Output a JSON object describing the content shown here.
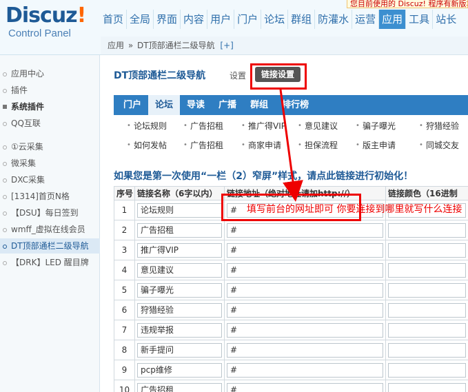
{
  "header": {
    "logo_title": "Discuz",
    "logo_bang": "!",
    "logo_subtitle": "Control Panel",
    "notice": "您目前使用的 Discuz! 程序有新版本",
    "nav": [
      "首页",
      "全局",
      "界面",
      "内容",
      "用户",
      "门户",
      "论坛",
      "群组",
      "防灌水",
      "运营",
      "应用",
      "工具",
      "站长"
    ],
    "nav_active_index": 10
  },
  "breadcrumb": {
    "root": "应用",
    "separator": "»",
    "current": "DT顶部通栏二级导航",
    "add": "[+]"
  },
  "sidebar": {
    "items": [
      {
        "label": "应用中心",
        "type": "item"
      },
      {
        "label": "插件",
        "type": "item"
      },
      {
        "label": "系统插件",
        "type": "group"
      },
      {
        "label": "QQ互联",
        "type": "item"
      },
      {
        "label": "①云采集",
        "type": "item"
      },
      {
        "label": "微采集",
        "type": "item"
      },
      {
        "label": "DXC采集",
        "type": "item"
      },
      {
        "label": "[1314]首页N格",
        "type": "item"
      },
      {
        "label": "【DSU】每日签到",
        "type": "item"
      },
      {
        "label": "wmff_虚拟在线会员",
        "type": "item"
      },
      {
        "label": "DT顶部通栏二级导航",
        "type": "current"
      },
      {
        "label": "【DRK】LED 醒目牌",
        "type": "item"
      }
    ]
  },
  "main": {
    "title": "DT顶部通栏二级导航",
    "tab_settings": "设置",
    "tab_links": "链接设置",
    "subnav": [
      "门户",
      "论坛",
      "导读",
      "广播",
      "群组",
      "排行榜"
    ],
    "subnav_active_index": 1,
    "menu_row1": [
      "论坛规则",
      "广告招租",
      "推广得VIP",
      "意见建议",
      "骗子曝光",
      "狩猎经验"
    ],
    "menu_row2": [
      "如何发帖",
      "广告招租",
      "商家申请",
      "担保流程",
      "版主申请",
      "同城交友"
    ],
    "hint": "如果您是第一次使用“一栏（2）窄屏”样式，请点此链接进行初始化！",
    "table": {
      "headers": [
        "序号",
        "链接名称（6字以内）",
        "链接地址（绝对地址请加http://）",
        "链接颜色（16进制"
      ],
      "rows": [
        {
          "num": "1",
          "name": "论坛规则",
          "url": "#"
        },
        {
          "num": "2",
          "name": "广告招租",
          "url": "#"
        },
        {
          "num": "3",
          "name": "推广得VIP",
          "url": "#"
        },
        {
          "num": "4",
          "name": "意见建议",
          "url": "#"
        },
        {
          "num": "5",
          "name": "骗子曝光",
          "url": "#"
        },
        {
          "num": "6",
          "name": "狩猎经验",
          "url": "#"
        },
        {
          "num": "7",
          "name": "违规举报",
          "url": "#"
        },
        {
          "num": "8",
          "name": "新手提问",
          "url": "#"
        },
        {
          "num": "9",
          "name": "pcp维修",
          "url": "#"
        },
        {
          "num": "10",
          "name": "广告招租",
          "url": "#"
        }
      ]
    },
    "annotation": "填写前台的网址即可  你要连接到哪里就写什么连接"
  }
}
